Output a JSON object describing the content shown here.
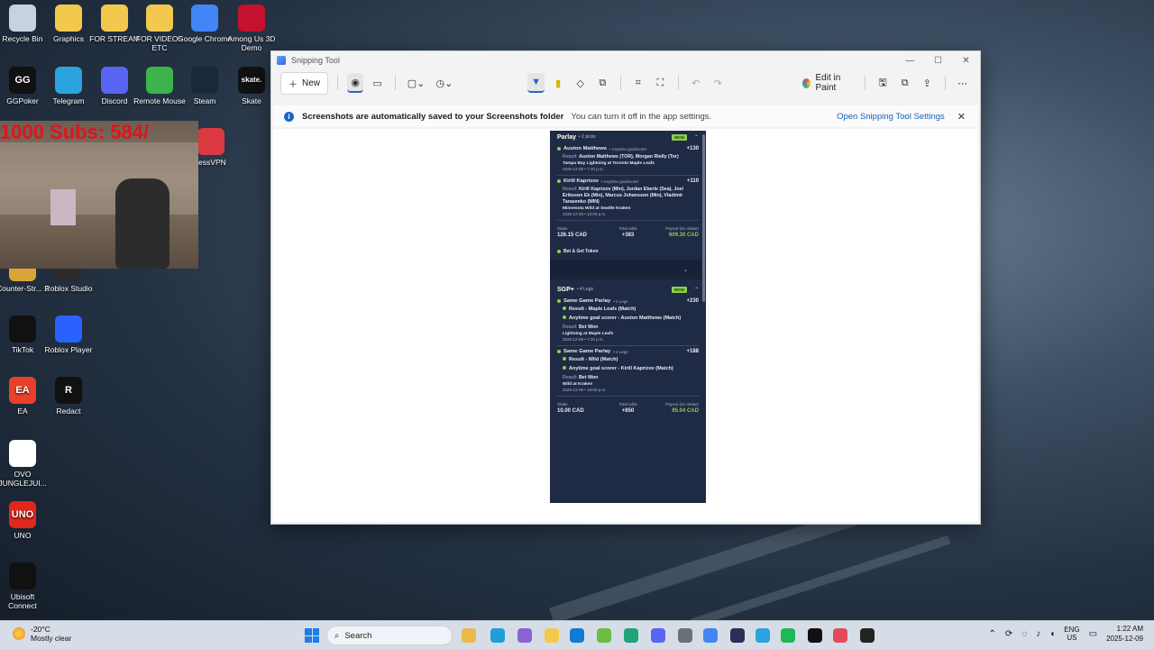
{
  "desktop": {
    "icons": [
      {
        "label": "Recycle Bin",
        "icon": "recycle-bin-icon",
        "color": "#c8d2de"
      },
      {
        "label": "Graphics",
        "icon": "folder-icon",
        "color": "#f2c94c"
      },
      {
        "label": "FOR STREAM",
        "icon": "folder-icon",
        "color": "#f2c94c"
      },
      {
        "label": "FOR VIDEOS ETC",
        "icon": "folder-icon",
        "color": "#f2c94c"
      },
      {
        "label": "Google Chrome",
        "icon": "chrome-icon",
        "color": "#4285f4"
      },
      {
        "label": "Among Us 3D Demo",
        "icon": "among-us-icon",
        "color": "#c5112d"
      },
      {
        "label": "GGPoker",
        "icon": "ggpoker-icon",
        "color": "#111111",
        "glyph": "GG"
      },
      {
        "label": "Telegram",
        "icon": "telegram-icon",
        "color": "#2aa3df"
      },
      {
        "label": "Discord",
        "icon": "discord-icon",
        "color": "#5865f2"
      },
      {
        "label": "Remote Mouse",
        "icon": "remote-mouse-icon",
        "color": "#3cb44b"
      },
      {
        "label": "Steam",
        "icon": "steam-icon",
        "color": "#1b2838"
      },
      {
        "label": "Skate",
        "icon": "skate-icon",
        "color": "#111111",
        "glyph": "skate."
      },
      {
        "label": "ressVPN",
        "icon": "expressvpn-icon",
        "color": "#da3940"
      },
      {
        "label": "Counter-Str... 2",
        "icon": "counter-strike-icon",
        "color": "#d9a536"
      },
      {
        "label": "Roblox Studio",
        "icon": "roblox-studio-icon",
        "color": "#2c2c2c"
      },
      {
        "label": "TikTok",
        "icon": "tiktok-icon",
        "color": "#111111"
      },
      {
        "label": "Roblox Player",
        "icon": "roblox-player-icon",
        "color": "#2962ff"
      },
      {
        "label": "EA",
        "icon": "ea-icon",
        "color": "#e8402a",
        "glyph": "EA"
      },
      {
        "label": "Redact",
        "icon": "redact-icon",
        "color": "#111111",
        "glyph": "R"
      },
      {
        "label": "OVO JUNGLEJUI...",
        "icon": "document-icon",
        "color": "#ffffff"
      },
      {
        "label": "UNO",
        "icon": "uno-icon",
        "color": "#e1261c",
        "glyph": "UNO"
      },
      {
        "label": "Ubisoft Connect",
        "icon": "ubisoft-icon",
        "color": "#111111"
      }
    ]
  },
  "webcam": {
    "overlay_text": "1000  Subs: 584/"
  },
  "window": {
    "title": "Snipping Tool",
    "toolbar": {
      "new_label": "New",
      "edit_in_paint": "Edit in Paint"
    },
    "infobar": {
      "bold": "Screenshots are automatically saved to your Screenshots folder",
      "message": "You can turn it off in the app settings.",
      "link": "Open Snipping Tool Settings"
    }
  },
  "slip": {
    "parlay": {
      "title": "Parlay",
      "sub": "• 2 picks",
      "badge": "WON",
      "legs": [
        {
          "name": "Auston Matthews",
          "market": "• Anytime goalscorer",
          "odds": "+130",
          "result_label": "Result:",
          "result": "Auston Matthews (TOR), Morgan Rielly (Tor)",
          "game": "Tampa Bay Lightning at Toronto Maple Leafs",
          "date": "2025-12-08 • 7:30 p.m."
        },
        {
          "name": "Kirill Kaprizov",
          "market": "• Anytime goalscorer",
          "odds": "+110",
          "result_label": "Result:",
          "result": "Kirill Kaprizov (Min), Jordan Eberle (Sea), Joel Eriksson Ek (Min), Marcus Johansson (Min), Vladimir Tarasenko (MIN)",
          "game": "Minnesota Wild at Seattle Kraken",
          "date": "2025-12-08 • 10:00 p.m."
        }
      ],
      "stake_label": "Stake",
      "stake": "126.15 CAD",
      "odds_label": "Total odds",
      "total_odds": "+383",
      "payout_label": "Payout (inc.Stake)",
      "payout": "609.30 CAD",
      "token": "Bet & Get Token"
    },
    "sgp": {
      "title": "SGP+",
      "sub": "• 4 Legs",
      "badge": "WON",
      "legs": [
        {
          "name": "Same Game Parlay",
          "market": "• 2 Legs",
          "odds": "+230",
          "subs": [
            "Result - Maple Leafs (Match)",
            "Anytime goal scorer - Auston Matthews (Match)"
          ],
          "result_label": "Result:",
          "result": "Bet Won",
          "game": "Lightning at Maple Leafs",
          "date": "2025-12-08 • 7:30 p.m."
        },
        {
          "name": "Same Game Parlay",
          "market": "• 2 Legs",
          "odds": "+188",
          "subs": [
            "Result - Wild (Match)",
            "Anytime goal scorer - Kirill Kaprizov (Match)"
          ],
          "result_label": "Result:",
          "result": "Bet Won",
          "game": "Wild at Kraken",
          "date": "2025-12-08 • 10:00 p.m."
        }
      ],
      "stake_label": "Stake",
      "stake": "10.00 CAD",
      "odds_label": "Total odds",
      "total_odds": "+850",
      "payout_label": "Payout (inc.Stake)",
      "payout": "95.04 CAD"
    }
  },
  "taskbar": {
    "weather_temp": "-20°C",
    "weather_desc": "Mostly clear",
    "search_placeholder": "Search",
    "lang_top": "ENG",
    "lang_bottom": "US",
    "time": "1:22 AM",
    "date": "2025-12-09",
    "apps": [
      {
        "icon": "file-explorer-icon",
        "color": "#e9b949"
      },
      {
        "icon": "edge-icon",
        "color": "#1f9ed9"
      },
      {
        "icon": "copilot-icon",
        "color": "#8a63d2"
      },
      {
        "icon": "folder-icon",
        "color": "#f2c94c"
      },
      {
        "icon": "edge-icon",
        "color": "#0f7bd6"
      },
      {
        "icon": "game-icon",
        "color": "#6abf40"
      },
      {
        "icon": "notes-icon",
        "color": "#1fa37a"
      },
      {
        "icon": "discord-icon",
        "color": "#5865f2"
      },
      {
        "icon": "settings-icon",
        "color": "#6a6f78"
      },
      {
        "icon": "chrome-icon",
        "color": "#4285f4"
      },
      {
        "icon": "vscode-icon",
        "color": "#2d2d55"
      },
      {
        "icon": "telegram-icon",
        "color": "#2aa3df"
      },
      {
        "icon": "spotify-icon",
        "color": "#1db954"
      },
      {
        "icon": "tiktok-icon",
        "color": "#111111"
      },
      {
        "icon": "snipping-tool-icon",
        "color": "#e24c5a"
      },
      {
        "icon": "obs-icon",
        "color": "#222222"
      }
    ]
  },
  "colors": {
    "slip_bg": "#1f2a44",
    "won_green": "#8bcf4d",
    "accent": "#1a5fb4"
  }
}
